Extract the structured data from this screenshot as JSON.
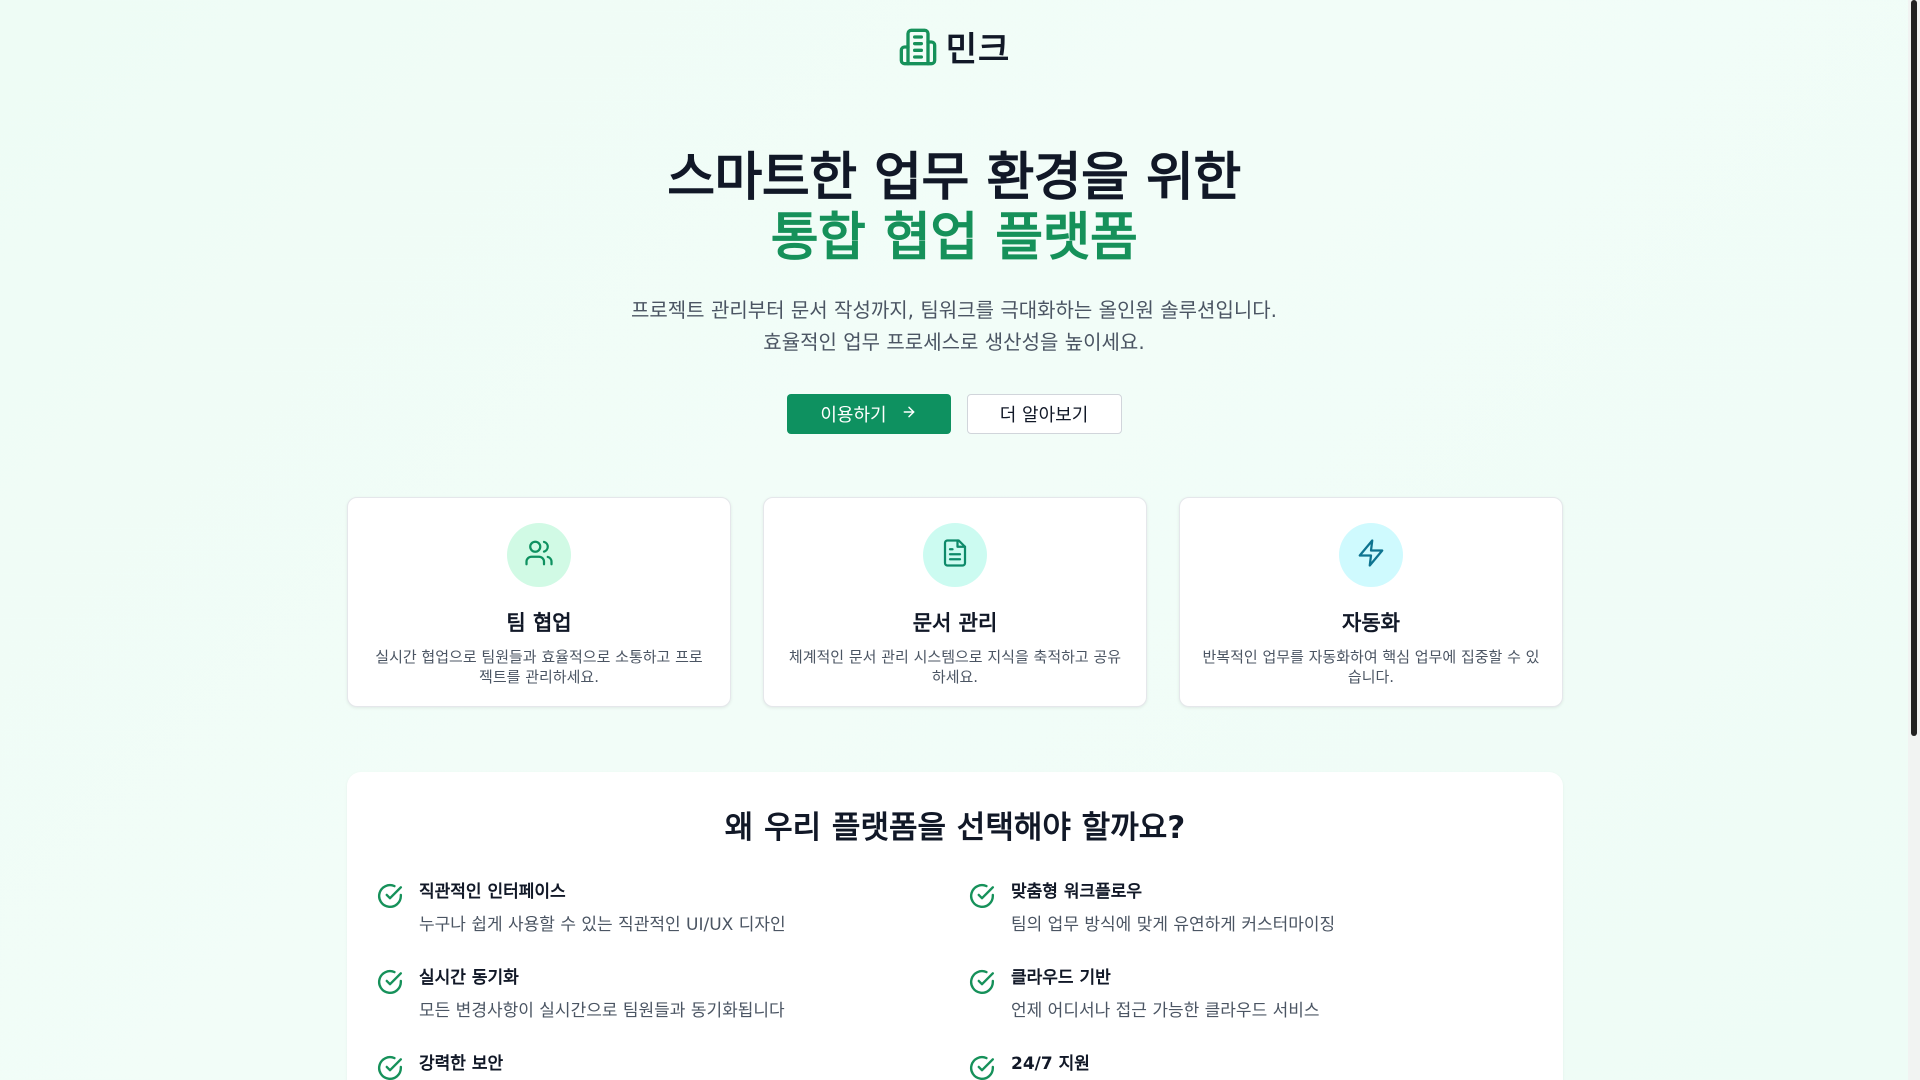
{
  "header": {
    "brand": "민크"
  },
  "hero": {
    "title_line1": "스마트한 업무 환경을 위한",
    "title_line2": "통합 협업 플랫폼",
    "desc_line1": "프로젝트 관리부터 문서 작성까지, 팀워크를 극대화하는 올인원 솔루션입니다.",
    "desc_line2": "효율적인 업무 프로세스로 생산성을 높이세요.",
    "primary_button": "이용하기",
    "secondary_button": "더 알아보기"
  },
  "features": [
    {
      "icon": "users-icon",
      "title": "팀 협업",
      "desc": "실시간 협업으로 팀원들과 효율적으로 소통하고 프로젝트를 관리하세요.",
      "color": "#d1fae5"
    },
    {
      "icon": "document-icon",
      "title": "문서 관리",
      "desc": "체계적인 문서 관리 시스템으로 지식을 축적하고 공유하세요.",
      "color": "#ccfbf1"
    },
    {
      "icon": "lightning-icon",
      "title": "자동화",
      "desc": "반복적인 업무를 자동화하여 핵심 업무에 집중할 수 있습니다.",
      "color": "#cffafe"
    }
  ],
  "why": {
    "title": "왜 우리 플랫폼을 선택해야 할까요?",
    "items": [
      {
        "title": "직관적인 인터페이스",
        "desc": "누구나 쉽게 사용할 수 있는 직관적인 UI/UX 디자인"
      },
      {
        "title": "맞춤형 워크플로우",
        "desc": "팀의 업무 방식에 맞게 유연하게 커스터마이징"
      },
      {
        "title": "실시간 동기화",
        "desc": "모든 변경사항이 실시간으로 팀원들과 동기화됩니다"
      },
      {
        "title": "클라우드 기반",
        "desc": "언제 어디서나 접근 가능한 클라우드 서비스"
      },
      {
        "title": "강력한 보안",
        "desc": ""
      },
      {
        "title": "24/7 지원",
        "desc": ""
      }
    ]
  },
  "colors": {
    "accent": "#0e9160",
    "title_accent": "#16915a",
    "background": "#eefcf5"
  }
}
